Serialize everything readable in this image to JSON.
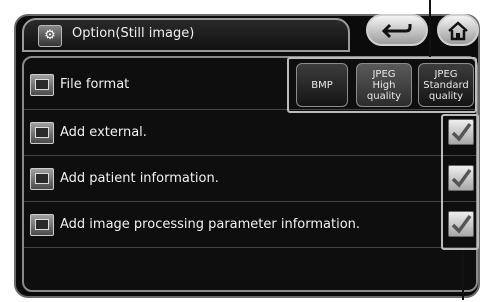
{
  "header": {
    "title": "Option(Still image)",
    "back_icon": "back-arrow-icon",
    "home_icon": "home-icon"
  },
  "file_format": {
    "label": "File format",
    "options": [
      "BMP",
      "JPEG\nHigh\nquality",
      "JPEG\nStandard\nquality"
    ]
  },
  "settings": [
    {
      "label": "Add external.",
      "checked": true
    },
    {
      "label": "Add patient information.",
      "checked": true
    },
    {
      "label": "Add image processing parameter information.",
      "checked": true
    }
  ]
}
